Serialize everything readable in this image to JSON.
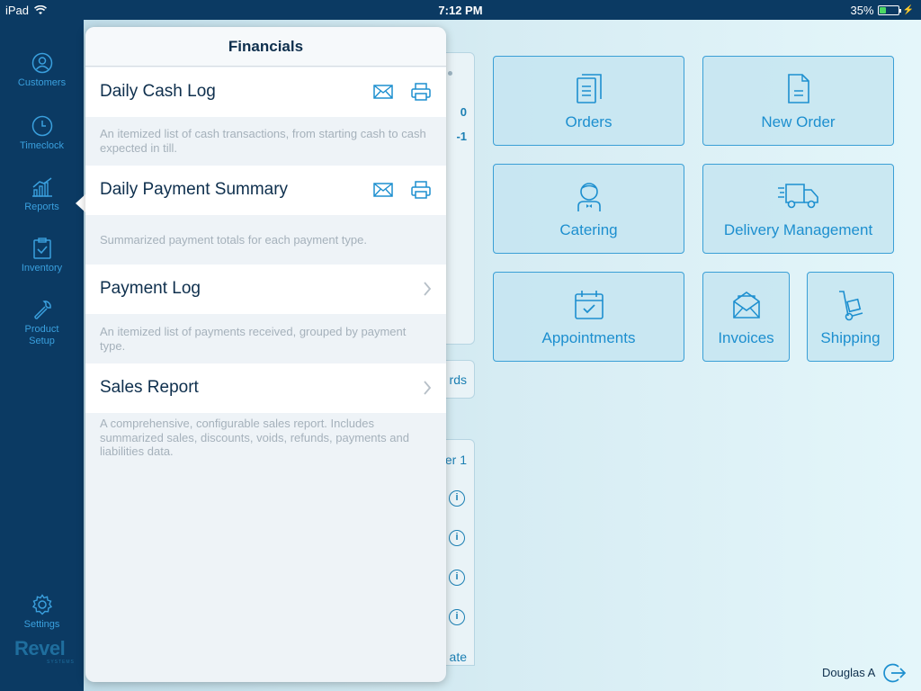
{
  "status_bar": {
    "device": "iPad",
    "time": "7:12 PM",
    "battery": "35%",
    "battery_level": 0.35
  },
  "sidebar": {
    "items": [
      {
        "label": "Customers",
        "icon": "person-circle-icon"
      },
      {
        "label": "Timeclock",
        "icon": "clock-icon"
      },
      {
        "label": "Reports",
        "icon": "bar-chart-icon"
      },
      {
        "label": "Inventory",
        "icon": "clipboard-check-icon"
      },
      {
        "label": "Product Setup",
        "icon": "wrench-icon"
      },
      {
        "label": "Settings",
        "icon": "gear-icon"
      }
    ],
    "logo": "Revel",
    "logo_sub": "SYSTEMS"
  },
  "background": {
    "numbers": [
      "0",
      "-1"
    ],
    "card_text": "rds",
    "list_header": "er 1",
    "list_footer": "ate"
  },
  "tiles": [
    {
      "label": "Orders",
      "icon": "orders-document-icon"
    },
    {
      "label": "New Order",
      "icon": "new-order-document-icon"
    },
    {
      "label": "Catering",
      "icon": "chef-icon"
    },
    {
      "label": "Delivery Management",
      "icon": "delivery-truck-icon"
    },
    {
      "label": "Appointments",
      "icon": "calendar-check-icon"
    },
    {
      "label": "Invoices",
      "icon": "envelope-icon"
    },
    {
      "label": "Shipping",
      "icon": "hand-truck-icon"
    }
  ],
  "user": {
    "name": "Douglas A"
  },
  "popover": {
    "title": "Financials",
    "reports": [
      {
        "label": "Daily Cash Log",
        "description": "An itemized list of cash transactions, from starting cash to cash expected in till.",
        "actions": [
          "email-icon",
          "print-icon"
        ]
      },
      {
        "label": "Daily Payment Summary",
        "description": "Summarized payment totals for each payment type.",
        "actions": [
          "email-icon",
          "print-icon"
        ]
      },
      {
        "label": "Payment Log",
        "description": "An itemized list of payments received, grouped by payment type.",
        "actions": [
          "chevron-right-icon"
        ]
      },
      {
        "label": "Sales Report",
        "description": "A comprehensive, configurable sales report. Includes summarized sales, discounts, voids, refunds, payments and liabilities data.",
        "actions": [
          "chevron-right-icon"
        ]
      }
    ]
  },
  "colors": {
    "sidebar_bg": "#0b3a63",
    "accent": "#1d8fcf",
    "title_text": "#0e2f4d",
    "description_text": "#a5b1bb"
  }
}
